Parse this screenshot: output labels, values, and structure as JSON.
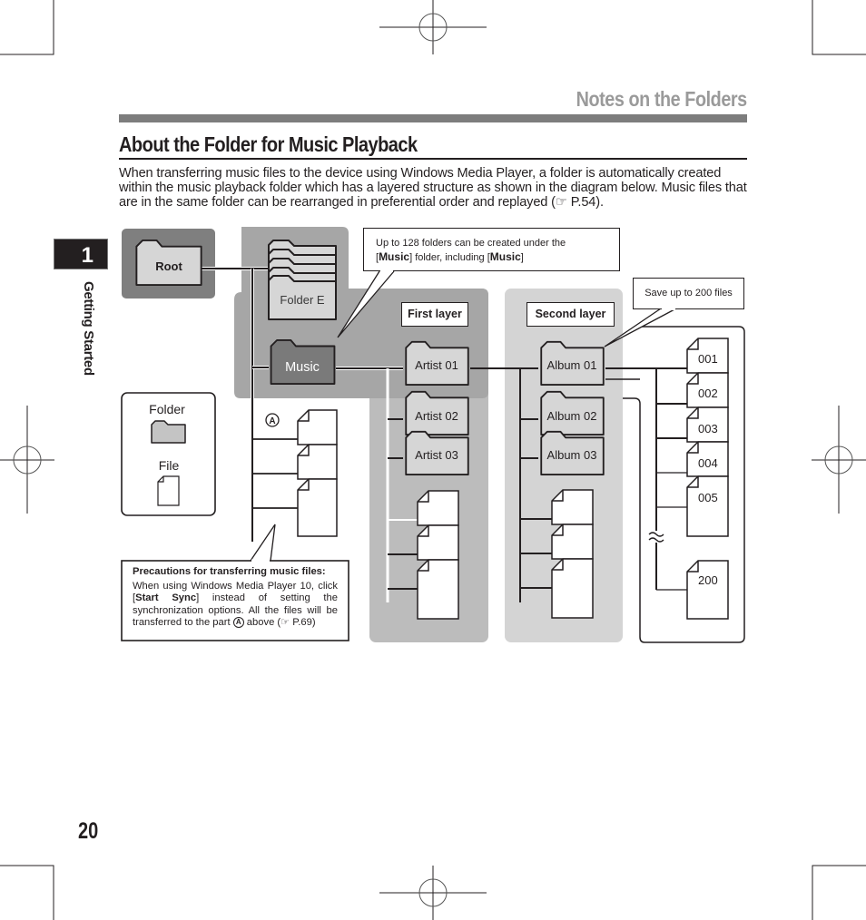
{
  "header": {
    "section_title": "Notes on the Folders",
    "page_heading": "About the Folder for Music Playback",
    "intro_text": "When transferring music files to the device using Windows Media Player, a folder is automatically created within the music playback folder which has a layered structure as shown in the diagram below. Music files that are in the same folder can be rearranged in preferential order and replayed (☞ P.54)."
  },
  "chapter": {
    "number": "1",
    "label": "Getting Started"
  },
  "page_number": "20",
  "diagram": {
    "root_label": "Root",
    "folder_e_label": "Folder E",
    "music_label": "Music",
    "part_marker": "A",
    "callout_folders": {
      "line1": "Up to 128 folders can be created under the",
      "line2_prefix": "[",
      "line2_bold1": "Music",
      "line2_mid": "] folder, including [",
      "line2_bold2": "Music",
      "line2_suffix": "]"
    },
    "callout_files": "Save up to 200 files",
    "first_layer_label": "First layer",
    "second_layer_label": "Second layer",
    "artists": [
      "Artist 01",
      "Artist 02",
      "Artist 03"
    ],
    "albums": [
      "Album 01",
      "Album 02",
      "Album 03"
    ],
    "files": [
      "001",
      "002",
      "003",
      "004",
      "005",
      "200"
    ],
    "legend": {
      "folder_label": "Folder",
      "file_label": "File"
    },
    "precautions": {
      "title": "Precautions for transferring music files:",
      "text_1": "When using Windows Media Player 10, click [",
      "bold": "Start Sync",
      "text_2": "] instead of setting the synchronization options. All the files will be transferred to the part ",
      "marker": "A",
      "text_3": " above (☞ P.69)"
    },
    "colors": {
      "root_panel": "#7f7f7f",
      "music_panel": "#a6a6a6",
      "first_layer_panel": "#bcbcbc",
      "second_layer_panel": "#d4d4d4",
      "folder_fill": "#d6d6d6",
      "music_folder_fill": "#7a7a7a",
      "ink": "#231f20"
    }
  }
}
